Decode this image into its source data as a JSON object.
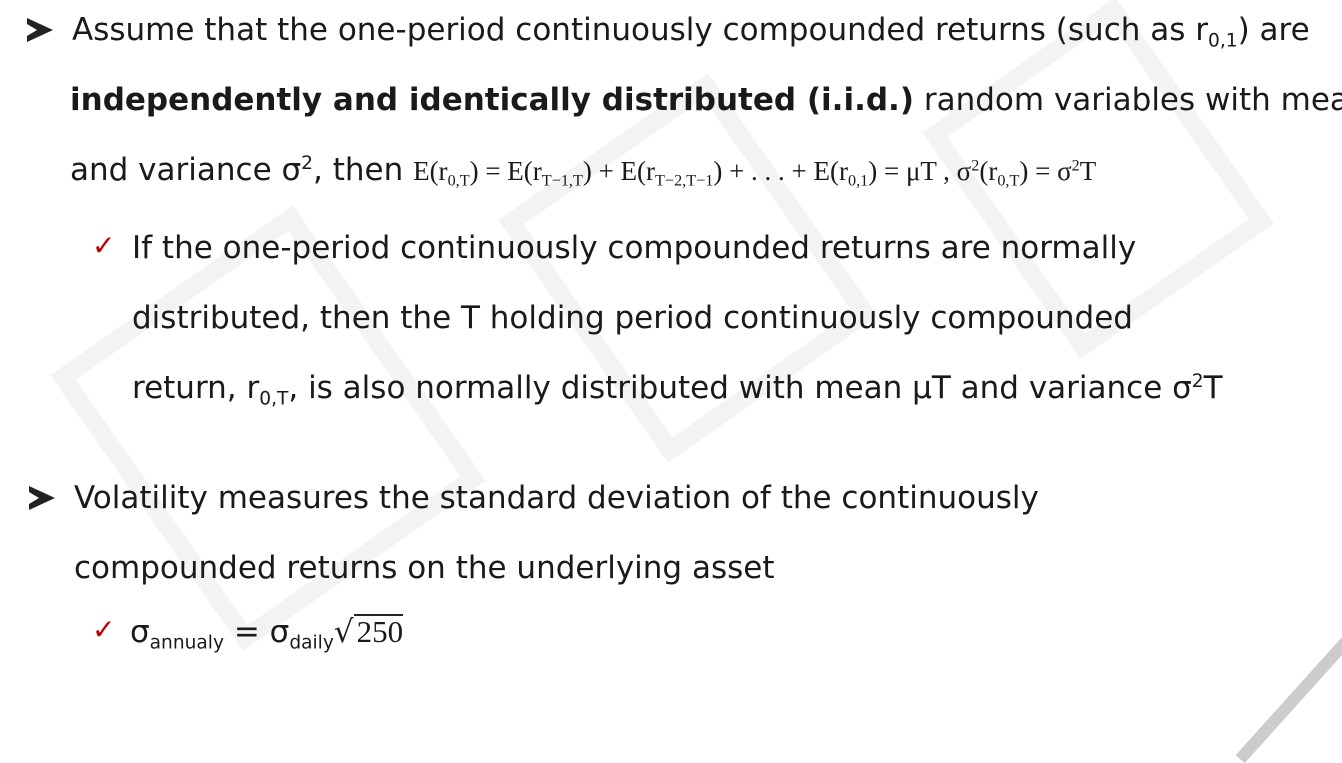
{
  "bullet1": {
    "part1": "Assume that the one-period continuously compounded returns (such as r",
    "sub1": "0,1",
    "part2": ") are",
    "bold": "independently and identically distributed (i.i.d.)",
    "part3": " random variables with mean μ",
    "part4": "and variance σ",
    "sup1": "2",
    "part5": ", then ",
    "formula_a": "E(r",
    "formula_a_sub": "0,T",
    "formula_b": ") = E(r",
    "formula_b_sub": "T−1,T",
    "formula_c": ") + E(r",
    "formula_c_sub": "T−2,T−1",
    "formula_d": ") + . . . + E(r",
    "formula_d_sub": "0,1",
    "formula_e": ") = μT ,  σ",
    "formula_e_sup": "2",
    "formula_f": "(r",
    "formula_f_sub": "0,T",
    "formula_g": ") = σ",
    "formula_g_sup": "2",
    "formula_h": "T"
  },
  "check1": {
    "line1": "If the one-period continuously compounded returns are normally",
    "line2": "distributed, then the T holding period continuously compounded",
    "line3a": "return, r",
    "line3sub": "0,T",
    "line3b": ", is also normally distributed with mean μT and variance σ",
    "line3sup": "2",
    "line3c": "T"
  },
  "bullet2": {
    "line1": "Volatility measures the standard deviation of the continuously",
    "line2": "compounded returns on the underlying asset"
  },
  "check2": {
    "sigma1": "σ",
    "sub1": "annualy",
    "eq": " = σ",
    "sub2": "daily",
    "radical": "√",
    "radicand": "250"
  }
}
